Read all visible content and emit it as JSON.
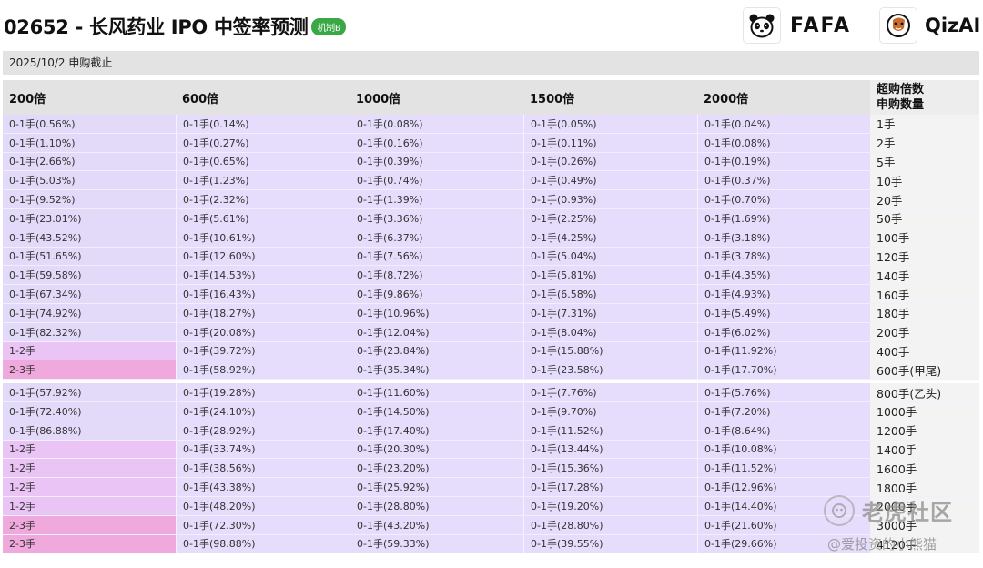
{
  "header": {
    "title": "02652 - 长风药业 IPO 中签率预测",
    "badge": "机制B",
    "logo_fafa": "FAFA",
    "logo_qiz": "QizAI"
  },
  "subbar": {
    "text": "2025/10/2 申购截止"
  },
  "table": {
    "columns": [
      "200倍",
      "600倍",
      "1000倍",
      "1500倍",
      "2000倍"
    ],
    "last_header_line1": "超购倍数",
    "last_header_line2": "申购数量",
    "group_a": [
      [
        "0-1手(0.56%)",
        "0-1手(0.14%)",
        "0-1手(0.08%)",
        "0-1手(0.05%)",
        "0-1手(0.04%)",
        "1手"
      ],
      [
        "0-1手(1.10%)",
        "0-1手(0.27%)",
        "0-1手(0.16%)",
        "0-1手(0.11%)",
        "0-1手(0.08%)",
        "2手"
      ],
      [
        "0-1手(2.66%)",
        "0-1手(0.65%)",
        "0-1手(0.39%)",
        "0-1手(0.26%)",
        "0-1手(0.19%)",
        "5手"
      ],
      [
        "0-1手(5.03%)",
        "0-1手(1.23%)",
        "0-1手(0.74%)",
        "0-1手(0.49%)",
        "0-1手(0.37%)",
        "10手"
      ],
      [
        "0-1手(9.52%)",
        "0-1手(2.32%)",
        "0-1手(1.39%)",
        "0-1手(0.93%)",
        "0-1手(0.70%)",
        "20手"
      ],
      [
        "0-1手(23.01%)",
        "0-1手(5.61%)",
        "0-1手(3.36%)",
        "0-1手(2.25%)",
        "0-1手(1.69%)",
        "50手"
      ],
      [
        "0-1手(43.52%)",
        "0-1手(10.61%)",
        "0-1手(6.37%)",
        "0-1手(4.25%)",
        "0-1手(3.18%)",
        "100手"
      ],
      [
        "0-1手(51.65%)",
        "0-1手(12.60%)",
        "0-1手(7.56%)",
        "0-1手(5.04%)",
        "0-1手(3.78%)",
        "120手"
      ],
      [
        "0-1手(59.58%)",
        "0-1手(14.53%)",
        "0-1手(8.72%)",
        "0-1手(5.81%)",
        "0-1手(4.35%)",
        "140手"
      ],
      [
        "0-1手(67.34%)",
        "0-1手(16.43%)",
        "0-1手(9.86%)",
        "0-1手(6.58%)",
        "0-1手(4.93%)",
        "160手"
      ],
      [
        "0-1手(74.92%)",
        "0-1手(18.27%)",
        "0-1手(10.96%)",
        "0-1手(7.31%)",
        "0-1手(5.49%)",
        "180手"
      ],
      [
        "0-1手(82.32%)",
        "0-1手(20.08%)",
        "0-1手(12.04%)",
        "0-1手(8.04%)",
        "0-1手(6.02%)",
        "200手"
      ],
      [
        "1-2手",
        "0-1手(39.72%)",
        "0-1手(23.84%)",
        "0-1手(15.88%)",
        "0-1手(11.92%)",
        "400手"
      ],
      [
        "2-3手",
        "0-1手(58.92%)",
        "0-1手(35.34%)",
        "0-1手(23.58%)",
        "0-1手(17.70%)",
        "600手(甲尾)"
      ]
    ],
    "group_b": [
      [
        "0-1手(57.92%)",
        "0-1手(19.28%)",
        "0-1手(11.60%)",
        "0-1手(7.76%)",
        "0-1手(5.76%)",
        "800手(乙头)"
      ],
      [
        "0-1手(72.40%)",
        "0-1手(24.10%)",
        "0-1手(14.50%)",
        "0-1手(9.70%)",
        "0-1手(7.20%)",
        "1000手"
      ],
      [
        "0-1手(86.88%)",
        "0-1手(28.92%)",
        "0-1手(17.40%)",
        "0-1手(11.52%)",
        "0-1手(8.64%)",
        "1200手"
      ],
      [
        "1-2手",
        "0-1手(33.74%)",
        "0-1手(20.30%)",
        "0-1手(13.44%)",
        "0-1手(10.08%)",
        "1400手"
      ],
      [
        "1-2手",
        "0-1手(38.56%)",
        "0-1手(23.20%)",
        "0-1手(15.36%)",
        "0-1手(11.52%)",
        "1600手"
      ],
      [
        "1-2手",
        "0-1手(43.38%)",
        "0-1手(25.92%)",
        "0-1手(17.28%)",
        "0-1手(12.96%)",
        "1800手"
      ],
      [
        "1-2手",
        "0-1手(48.20%)",
        "0-1手(28.80%)",
        "0-1手(19.20%)",
        "0-1手(14.40%)",
        "2000手"
      ],
      [
        "2-3手",
        "0-1手(72.30%)",
        "0-1手(43.20%)",
        "0-1手(28.80%)",
        "0-1手(21.60%)",
        "3000手"
      ],
      [
        "2-3手",
        "0-1手(98.88%)",
        "0-1手(59.33%)",
        "0-1手(39.55%)",
        "0-1手(29.66%)",
        "4120手"
      ]
    ]
  },
  "watermark": {
    "big": "老虎社区",
    "small": "@爱投资的小熊猫"
  },
  "colors": {
    "badge": "#3aa845",
    "cell": "#e6dcfb",
    "tier1": "#e9c4f5",
    "tier2": "#f0a9dc",
    "header_bg": "#e3e3e3"
  }
}
